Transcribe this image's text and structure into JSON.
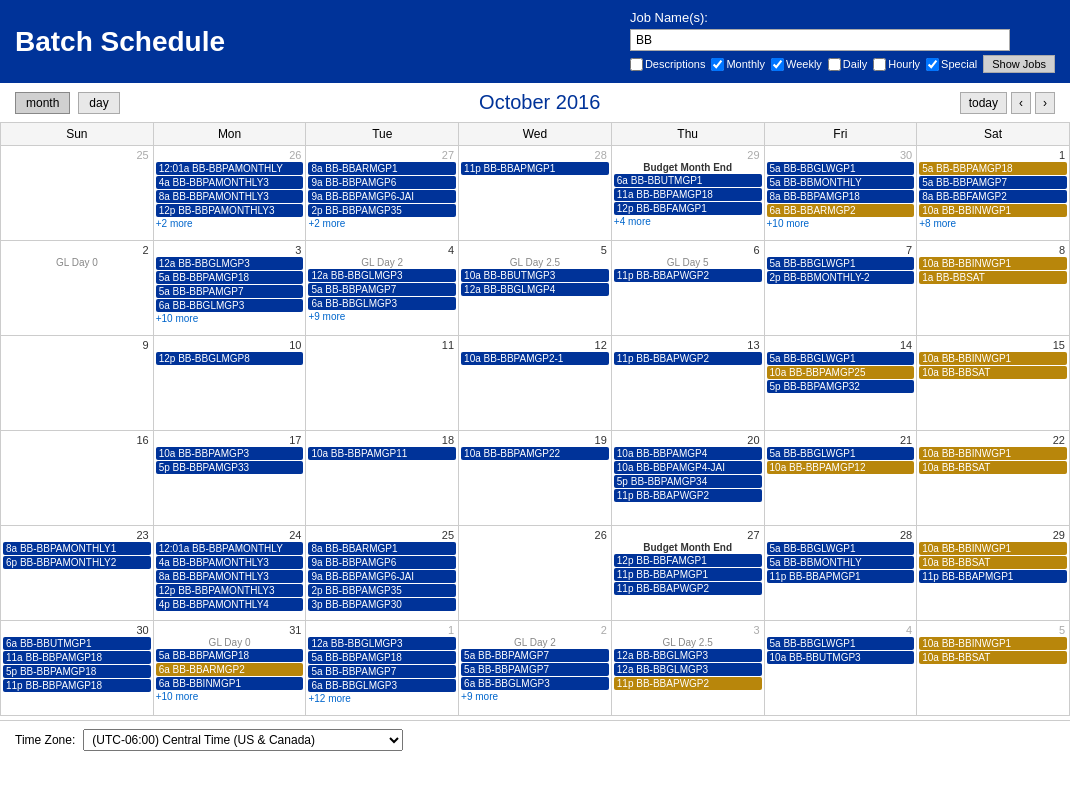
{
  "header": {
    "title": "Batch Schedule",
    "job_name_label": "Job Name(s):",
    "job_name_value": "BB",
    "filters": [
      {
        "label": "Descriptions",
        "checked": false
      },
      {
        "label": "Monthly",
        "checked": true
      },
      {
        "label": "Weekly",
        "checked": true
      },
      {
        "label": "Daily",
        "checked": false
      },
      {
        "label": "Hourly",
        "checked": false
      },
      {
        "label": "Special",
        "checked": true
      }
    ],
    "show_jobs_label": "Show Jobs"
  },
  "toolbar": {
    "month_label": "month",
    "day_label": "day",
    "current_month": "October 2016",
    "today_label": "today",
    "prev_label": "‹",
    "next_label": "›"
  },
  "weekdays": [
    "Sun",
    "Mon",
    "Tue",
    "Wed",
    "Thu",
    "Fri",
    "Sat"
  ],
  "footer": {
    "tz_label": "Time Zone:",
    "tz_value": "(UTC-06:00) Central Time (US & Canada)"
  }
}
